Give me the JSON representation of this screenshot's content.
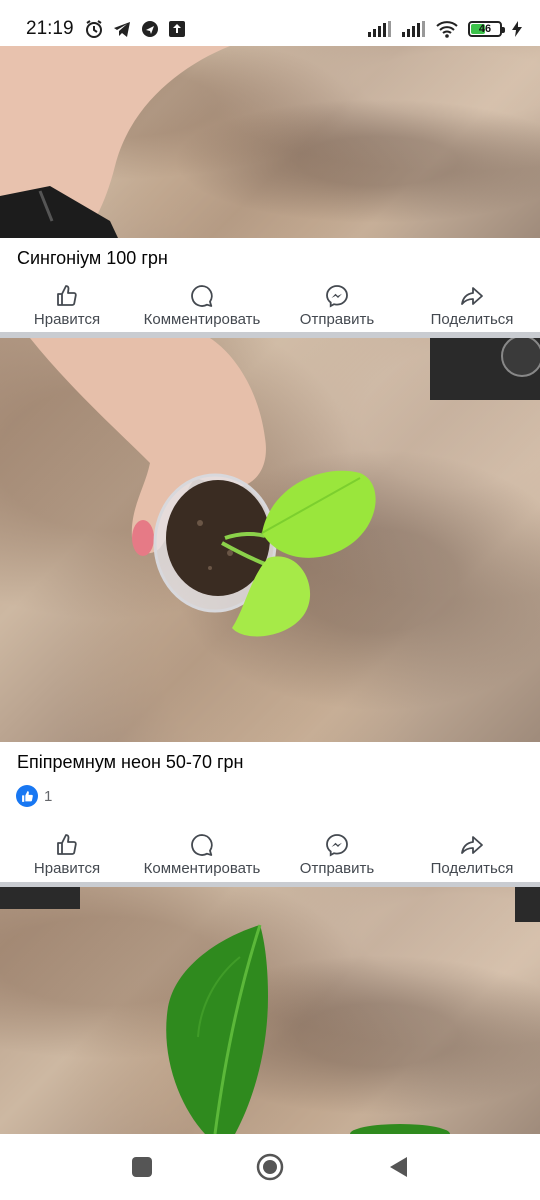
{
  "status_bar": {
    "time": "21:19",
    "battery_level": "46",
    "left_icons": [
      "alarm-icon",
      "telegram-icon",
      "direction-icon",
      "upload-icon"
    ],
    "right_icons": [
      "signal-icon",
      "signal-icon",
      "wifi-icon",
      "battery-icon",
      "charging-icon"
    ]
  },
  "posts": [
    {
      "caption": "Сингоніум 100 грн",
      "actions": {
        "like": "Нравится",
        "comment": "Комментировать",
        "send": "Отправить",
        "share": "Поделиться"
      }
    },
    {
      "caption": "Епіпремнум неон 50-70 грн",
      "reaction_count": "1",
      "actions": {
        "like": "Нравится",
        "comment": "Комментировать",
        "send": "Отправить",
        "share": "Поделиться"
      }
    }
  ],
  "nav_bar": {
    "buttons": [
      "recents-icon",
      "home-icon",
      "back-icon"
    ]
  },
  "colors": {
    "brand_blue": "#1877f2",
    "action_gray": "#444950",
    "divider": "#c9ccd1"
  }
}
